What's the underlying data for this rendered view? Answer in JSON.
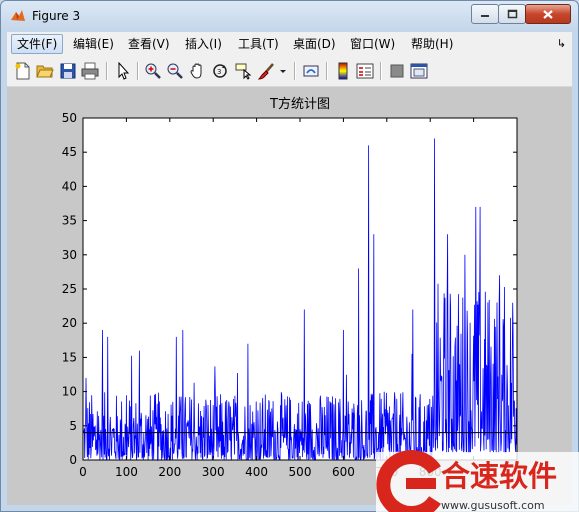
{
  "window": {
    "title": "Figure 3"
  },
  "menu": [
    {
      "label": "文件(F)"
    },
    {
      "label": "编辑(E)"
    },
    {
      "label": "查看(V)"
    },
    {
      "label": "插入(I)"
    },
    {
      "label": "工具(T)"
    },
    {
      "label": "桌面(D)"
    },
    {
      "label": "窗口(W)"
    },
    {
      "label": "帮助(H)"
    }
  ],
  "toolbar_icons": [
    "new-figure-icon",
    "open-icon",
    "save-icon",
    "print-icon",
    "edit-plot-arrow-icon",
    "zoom-in-icon",
    "zoom-out-icon",
    "pan-hand-icon",
    "rotate-3d-icon",
    "data-cursor-icon",
    "brush-icon",
    "brush-dropdown-icon",
    "link-plot-icon",
    "colorbar-icon",
    "legend-icon",
    "hide-plot-tools-icon",
    "show-plot-tools-icon"
  ],
  "watermark": {
    "brand_text": "合速软件",
    "url_text": "www.gususoft.com",
    "color": "#d9261c"
  },
  "chart_data": {
    "type": "line",
    "title": "T方统计图",
    "xlim": [
      0,
      1000
    ],
    "ylim": [
      0,
      50
    ],
    "xticks": [
      0,
      100,
      200,
      300,
      400,
      500,
      600,
      700,
      800,
      900,
      1000
    ],
    "yticks": [
      0,
      5,
      10,
      15,
      20,
      25,
      30,
      35,
      40,
      45,
      50
    ],
    "xtick_labels_visible": [
      "0",
      "100",
      "200",
      "300",
      "400",
      "500",
      "600",
      "700",
      "800"
    ],
    "ytick_labels": [
      "0",
      "5",
      "10",
      "15",
      "20",
      "25",
      "30",
      "35",
      "40",
      "45",
      "50"
    ],
    "series_color": "#0000ff",
    "threshold": {
      "y": 4,
      "color": "#000000"
    },
    "peaks": [
      {
        "x": 7,
        "y": 12
      },
      {
        "x": 45,
        "y": 19
      },
      {
        "x": 57,
        "y": 18
      },
      {
        "x": 130,
        "y": 16
      },
      {
        "x": 215,
        "y": 18
      },
      {
        "x": 230,
        "y": 19
      },
      {
        "x": 380,
        "y": 17
      },
      {
        "x": 510,
        "y": 22
      },
      {
        "x": 600,
        "y": 19
      },
      {
        "x": 635,
        "y": 28
      },
      {
        "x": 658,
        "y": 46
      },
      {
        "x": 670,
        "y": 33
      },
      {
        "x": 760,
        "y": 22
      },
      {
        "x": 810,
        "y": 47
      },
      {
        "x": 840,
        "y": 33
      },
      {
        "x": 880,
        "y": 30
      },
      {
        "x": 905,
        "y": 37
      },
      {
        "x": 915,
        "y": 37
      },
      {
        "x": 960,
        "y": 27
      },
      {
        "x": 990,
        "y": 23
      }
    ],
    "baseline_range": [
      0,
      10
    ],
    "high_regime_start_x": 810,
    "high_regime_range": [
      5,
      25
    ]
  }
}
